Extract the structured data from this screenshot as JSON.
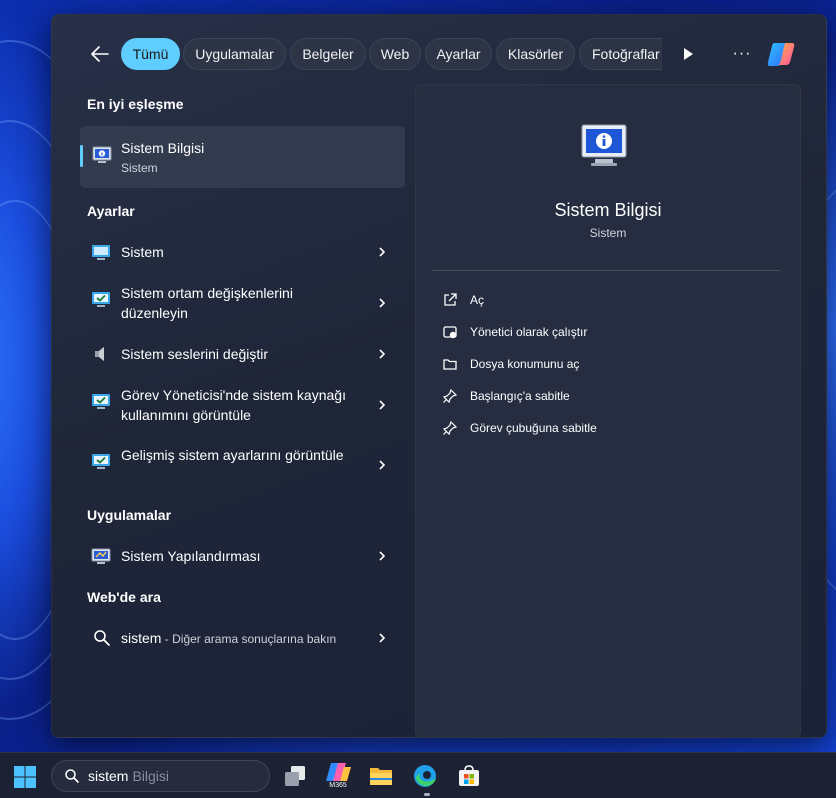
{
  "filters": {
    "back_label": "←",
    "tabs": [
      {
        "label": "Tümü",
        "active": true
      },
      {
        "label": "Uygulamalar"
      },
      {
        "label": "Belgeler"
      },
      {
        "label": "Web"
      },
      {
        "label": "Ayarlar"
      },
      {
        "label": "Klasörler"
      },
      {
        "label": "Fotoğraflar"
      }
    ],
    "more_label": "···"
  },
  "results": {
    "best_match_heading": "En iyi eşleşme",
    "best_match": {
      "title": "Sistem Bilgisi",
      "subtitle": "Sistem"
    },
    "settings_heading": "Ayarlar",
    "settings": [
      {
        "label": "Sistem"
      },
      {
        "label": "Sistem ortam değişkenlerini düzenleyin"
      },
      {
        "label": "Sistem seslerini değiştir"
      },
      {
        "label": "Görev Yöneticisi'nde sistem kaynağı kullanımını görüntüle"
      },
      {
        "label": "Gelişmiş sistem ayarlarını görüntüle"
      }
    ],
    "apps_heading": "Uygulamalar",
    "apps": [
      {
        "label": "Sistem Yapılandırması"
      }
    ],
    "web_heading": "Web'de ara",
    "web": {
      "query": "sistem",
      "suffix": " - Diğer arama sonuçlarına bakın"
    }
  },
  "detail": {
    "title": "Sistem Bilgisi",
    "subtitle": "Sistem",
    "actions": [
      {
        "label": "Aç",
        "icon": "open-external-icon"
      },
      {
        "label": "Yönetici olarak çalıştır",
        "icon": "shield-admin-icon"
      },
      {
        "label": "Dosya konumunu aç",
        "icon": "folder-icon"
      },
      {
        "label": "Başlangıç'a sabitle",
        "icon": "pin-icon"
      },
      {
        "label": "Görev çubuğuna sabitle",
        "icon": "pin-icon"
      }
    ]
  },
  "taskbar": {
    "search_typed": "sistem",
    "search_suggestion": "Bilgisi",
    "m365_label": "M365",
    "apps": [
      "task-view",
      "microsoft-365",
      "file-explorer",
      "edge",
      "microsoft-store"
    ]
  },
  "colors": {
    "accent": "#60cdff",
    "panel": "#1f2638",
    "pane": "#262d40",
    "taskbar": "#1c2233"
  }
}
